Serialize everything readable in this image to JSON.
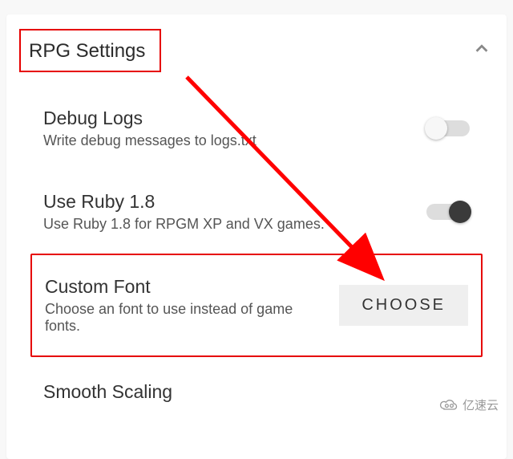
{
  "section": {
    "title": "RPG Settings"
  },
  "items": {
    "debugLogs": {
      "title": "Debug Logs",
      "desc": "Write debug messages to logs.txt",
      "enabled": false
    },
    "useRuby": {
      "title": "Use Ruby 1.8",
      "desc": "Use Ruby 1.8 for RPGM XP and VX games.",
      "enabled": true
    },
    "customFont": {
      "title": "Custom Font",
      "desc": "Choose an font to use instead of game fonts.",
      "button": "CHOOSE"
    },
    "smoothScaling": {
      "title": "Smooth Scaling"
    }
  },
  "watermark": {
    "text": "亿速云"
  },
  "annotation": {
    "header_highlight": true,
    "custom_font_highlight": true,
    "arrow_color": "#ff0000"
  }
}
